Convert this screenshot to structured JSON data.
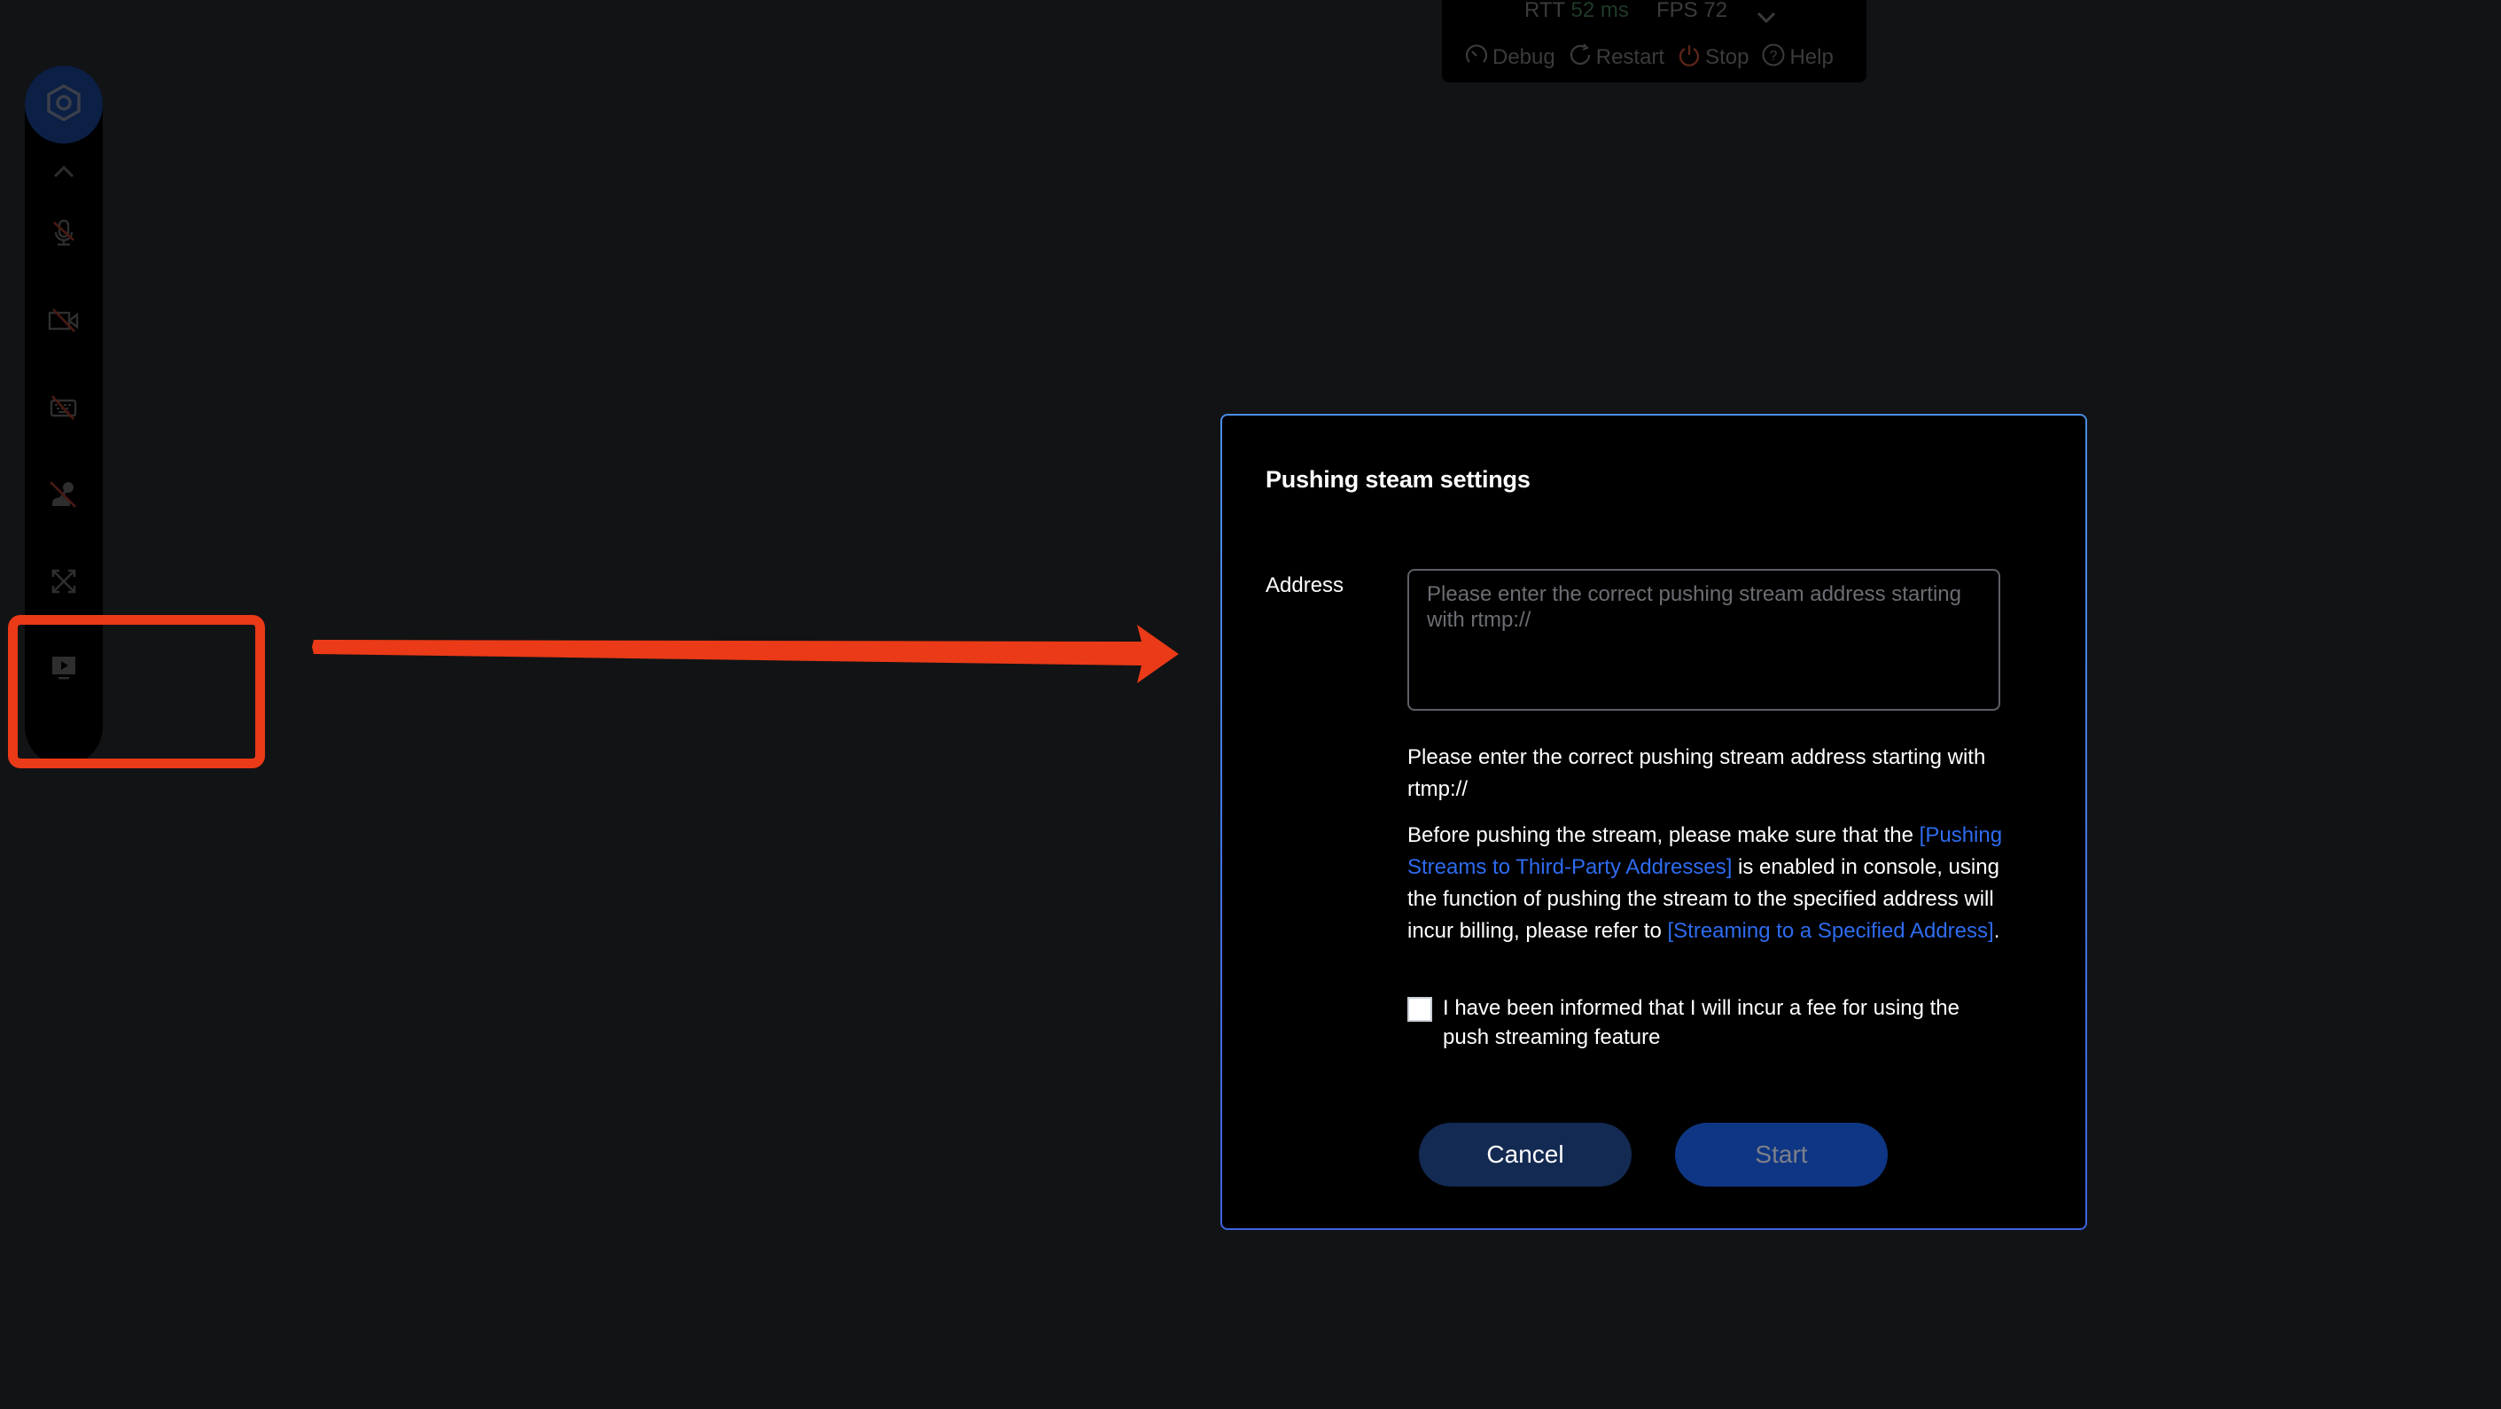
{
  "toolbar": {
    "rtt_label": "RTT",
    "rtt_value": "52 ms",
    "fps_label": "FPS 72",
    "expand_icon": "chevron-down-icon",
    "actions": [
      {
        "label": "Debug",
        "icon": "speedometer-icon"
      },
      {
        "label": "Restart",
        "icon": "restart-icon"
      },
      {
        "label": "Stop",
        "icon": "power-icon"
      },
      {
        "label": "Help",
        "icon": "help-icon"
      }
    ],
    "colors": {
      "rtt_value": "#1f3a28",
      "stop_icon": "#5a2418"
    }
  },
  "sidebar": {
    "logo_icon": "hexagon-logo-icon",
    "collapse_icon": "chevron-up-icon",
    "items": [
      {
        "name": "microphone",
        "icon": "mic-off-icon",
        "state": "disabled"
      },
      {
        "name": "camera",
        "icon": "camera-off-icon",
        "state": "disabled"
      },
      {
        "name": "keyboard",
        "icon": "keyboard-off-icon",
        "state": "disabled"
      },
      {
        "name": "joystick",
        "icon": "joystick-off-icon",
        "state": "disabled"
      },
      {
        "name": "fullscreen",
        "icon": "fullscreen-icon",
        "state": "enabled"
      },
      {
        "name": "push-stream",
        "icon": "screen-play-icon",
        "state": "enabled"
      }
    ]
  },
  "annotation": {
    "highlight_color": "#ea3a17",
    "arrow_color": "#ea3a17"
  },
  "dialog": {
    "title": "Pushing steam settings",
    "address_label": "Address",
    "address_value": "",
    "address_placeholder": "Please enter the correct pushing stream address starting with rtmp://",
    "help_text": "Please enter the correct pushing stream address starting with rtmp://",
    "notice": {
      "part1": "Before pushing the stream, please make sure that the ",
      "link1": "[Pushing Streams to Third-Party Addresses]",
      "part2": " is enabled in console, using the function of pushing the stream to the specified address will incur billing, please refer to ",
      "link2": "[Streaming to a Specified Address]",
      "part3": "."
    },
    "consent_label": "I have been informed that I will incur a fee for using the push streaming feature",
    "consent_checked": false,
    "cancel_label": "Cancel",
    "start_label": "Start",
    "colors": {
      "border_top": "#4a8fe6",
      "border_bottom": "#3e63e0",
      "link": "#2e6bf0",
      "cancel_bg": "#132a52",
      "start_bg": "#0f3684"
    }
  }
}
